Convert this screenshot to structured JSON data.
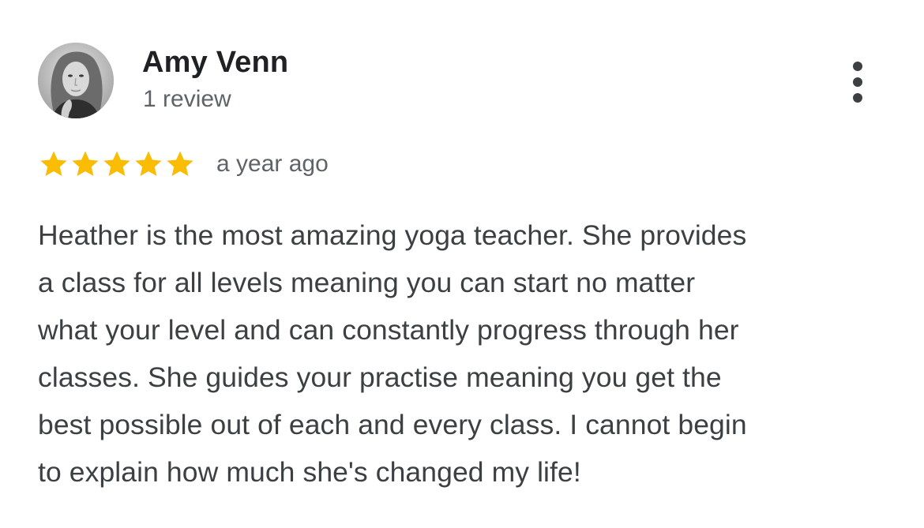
{
  "review": {
    "reviewer_name": "Amy Venn",
    "review_count": "1 review",
    "rating": 5,
    "rating_max": 5,
    "star_color": "#fbbc04",
    "date": "a year ago",
    "text_lines": [
      "Heather is the most amazing yoga teacher. She provides",
      "a class for all levels meaning you can start no matter",
      "what your level and can constantly progress through her",
      "classes. She guides your practise meaning you get the",
      "best possible out of each and every class. I cannot begin",
      "to explain how much she's changed my life!"
    ]
  },
  "icons": {
    "avatar": "profile-photo",
    "more": "more-vert-icon",
    "star": "star-icon"
  }
}
